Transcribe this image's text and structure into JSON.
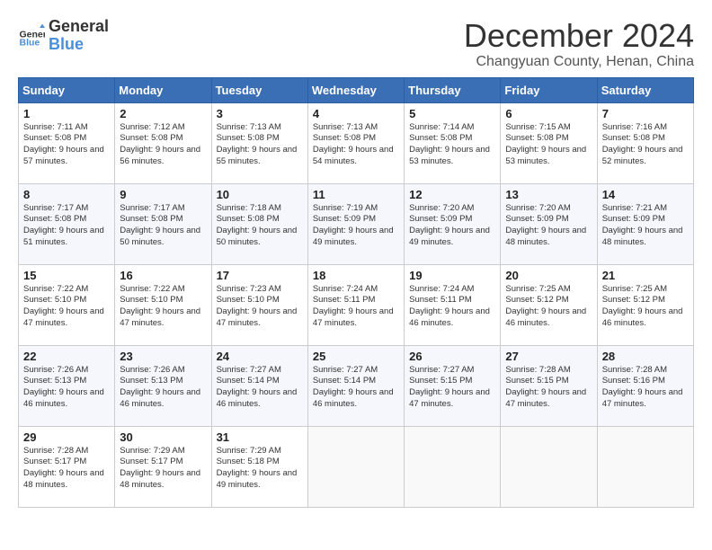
{
  "logo": {
    "general": "General",
    "blue": "Blue"
  },
  "title": "December 2024",
  "location": "Changyuan County, Henan, China",
  "weekdays": [
    "Sunday",
    "Monday",
    "Tuesday",
    "Wednesday",
    "Thursday",
    "Friday",
    "Saturday"
  ],
  "weeks": [
    [
      {
        "day": "1",
        "sunrise": "7:11 AM",
        "sunset": "5:08 PM",
        "daylight": "9 hours and 57 minutes."
      },
      {
        "day": "2",
        "sunrise": "7:12 AM",
        "sunset": "5:08 PM",
        "daylight": "9 hours and 56 minutes."
      },
      {
        "day": "3",
        "sunrise": "7:13 AM",
        "sunset": "5:08 PM",
        "daylight": "9 hours and 55 minutes."
      },
      {
        "day": "4",
        "sunrise": "7:13 AM",
        "sunset": "5:08 PM",
        "daylight": "9 hours and 54 minutes."
      },
      {
        "day": "5",
        "sunrise": "7:14 AM",
        "sunset": "5:08 PM",
        "daylight": "9 hours and 53 minutes."
      },
      {
        "day": "6",
        "sunrise": "7:15 AM",
        "sunset": "5:08 PM",
        "daylight": "9 hours and 53 minutes."
      },
      {
        "day": "7",
        "sunrise": "7:16 AM",
        "sunset": "5:08 PM",
        "daylight": "9 hours and 52 minutes."
      }
    ],
    [
      {
        "day": "8",
        "sunrise": "7:17 AM",
        "sunset": "5:08 PM",
        "daylight": "9 hours and 51 minutes."
      },
      {
        "day": "9",
        "sunrise": "7:17 AM",
        "sunset": "5:08 PM",
        "daylight": "9 hours and 50 minutes."
      },
      {
        "day": "10",
        "sunrise": "7:18 AM",
        "sunset": "5:08 PM",
        "daylight": "9 hours and 50 minutes."
      },
      {
        "day": "11",
        "sunrise": "7:19 AM",
        "sunset": "5:09 PM",
        "daylight": "9 hours and 49 minutes."
      },
      {
        "day": "12",
        "sunrise": "7:20 AM",
        "sunset": "5:09 PM",
        "daylight": "9 hours and 49 minutes."
      },
      {
        "day": "13",
        "sunrise": "7:20 AM",
        "sunset": "5:09 PM",
        "daylight": "9 hours and 48 minutes."
      },
      {
        "day": "14",
        "sunrise": "7:21 AM",
        "sunset": "5:09 PM",
        "daylight": "9 hours and 48 minutes."
      }
    ],
    [
      {
        "day": "15",
        "sunrise": "7:22 AM",
        "sunset": "5:10 PM",
        "daylight": "9 hours and 47 minutes."
      },
      {
        "day": "16",
        "sunrise": "7:22 AM",
        "sunset": "5:10 PM",
        "daylight": "9 hours and 47 minutes."
      },
      {
        "day": "17",
        "sunrise": "7:23 AM",
        "sunset": "5:10 PM",
        "daylight": "9 hours and 47 minutes."
      },
      {
        "day": "18",
        "sunrise": "7:24 AM",
        "sunset": "5:11 PM",
        "daylight": "9 hours and 47 minutes."
      },
      {
        "day": "19",
        "sunrise": "7:24 AM",
        "sunset": "5:11 PM",
        "daylight": "9 hours and 46 minutes."
      },
      {
        "day": "20",
        "sunrise": "7:25 AM",
        "sunset": "5:12 PM",
        "daylight": "9 hours and 46 minutes."
      },
      {
        "day": "21",
        "sunrise": "7:25 AM",
        "sunset": "5:12 PM",
        "daylight": "9 hours and 46 minutes."
      }
    ],
    [
      {
        "day": "22",
        "sunrise": "7:26 AM",
        "sunset": "5:13 PM",
        "daylight": "9 hours and 46 minutes."
      },
      {
        "day": "23",
        "sunrise": "7:26 AM",
        "sunset": "5:13 PM",
        "daylight": "9 hours and 46 minutes."
      },
      {
        "day": "24",
        "sunrise": "7:27 AM",
        "sunset": "5:14 PM",
        "daylight": "9 hours and 46 minutes."
      },
      {
        "day": "25",
        "sunrise": "7:27 AM",
        "sunset": "5:14 PM",
        "daylight": "9 hours and 46 minutes."
      },
      {
        "day": "26",
        "sunrise": "7:27 AM",
        "sunset": "5:15 PM",
        "daylight": "9 hours and 47 minutes."
      },
      {
        "day": "27",
        "sunrise": "7:28 AM",
        "sunset": "5:15 PM",
        "daylight": "9 hours and 47 minutes."
      },
      {
        "day": "28",
        "sunrise": "7:28 AM",
        "sunset": "5:16 PM",
        "daylight": "9 hours and 47 minutes."
      }
    ],
    [
      {
        "day": "29",
        "sunrise": "7:28 AM",
        "sunset": "5:17 PM",
        "daylight": "9 hours and 48 minutes."
      },
      {
        "day": "30",
        "sunrise": "7:29 AM",
        "sunset": "5:17 PM",
        "daylight": "9 hours and 48 minutes."
      },
      {
        "day": "31",
        "sunrise": "7:29 AM",
        "sunset": "5:18 PM",
        "daylight": "9 hours and 49 minutes."
      },
      null,
      null,
      null,
      null
    ]
  ]
}
